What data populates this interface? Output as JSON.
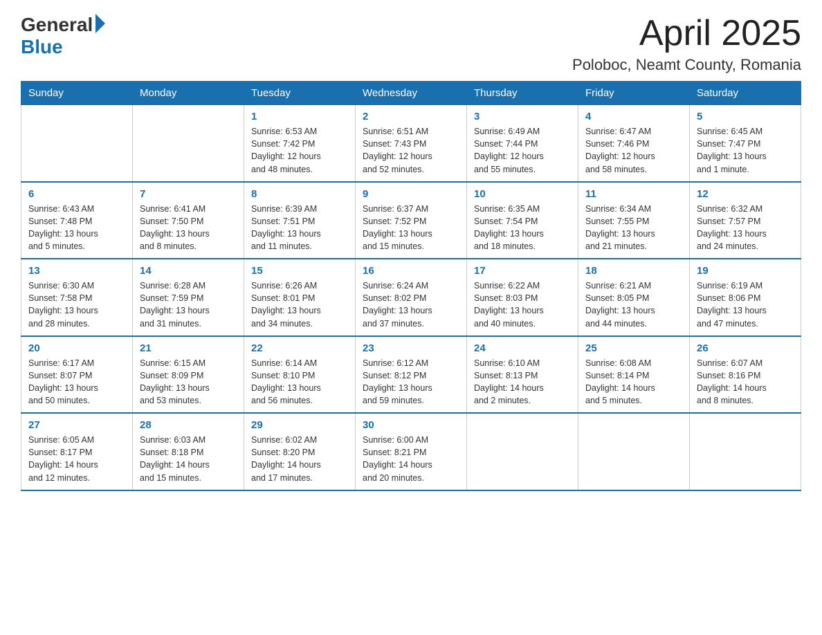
{
  "header": {
    "logo_general": "General",
    "logo_blue": "Blue",
    "month_title": "April 2025",
    "location": "Poloboc, Neamt County, Romania"
  },
  "days_of_week": [
    "Sunday",
    "Monday",
    "Tuesday",
    "Wednesday",
    "Thursday",
    "Friday",
    "Saturday"
  ],
  "weeks": [
    [
      {
        "day": "",
        "info": ""
      },
      {
        "day": "",
        "info": ""
      },
      {
        "day": "1",
        "info": "Sunrise: 6:53 AM\nSunset: 7:42 PM\nDaylight: 12 hours\nand 48 minutes."
      },
      {
        "day": "2",
        "info": "Sunrise: 6:51 AM\nSunset: 7:43 PM\nDaylight: 12 hours\nand 52 minutes."
      },
      {
        "day": "3",
        "info": "Sunrise: 6:49 AM\nSunset: 7:44 PM\nDaylight: 12 hours\nand 55 minutes."
      },
      {
        "day": "4",
        "info": "Sunrise: 6:47 AM\nSunset: 7:46 PM\nDaylight: 12 hours\nand 58 minutes."
      },
      {
        "day": "5",
        "info": "Sunrise: 6:45 AM\nSunset: 7:47 PM\nDaylight: 13 hours\nand 1 minute."
      }
    ],
    [
      {
        "day": "6",
        "info": "Sunrise: 6:43 AM\nSunset: 7:48 PM\nDaylight: 13 hours\nand 5 minutes."
      },
      {
        "day": "7",
        "info": "Sunrise: 6:41 AM\nSunset: 7:50 PM\nDaylight: 13 hours\nand 8 minutes."
      },
      {
        "day": "8",
        "info": "Sunrise: 6:39 AM\nSunset: 7:51 PM\nDaylight: 13 hours\nand 11 minutes."
      },
      {
        "day": "9",
        "info": "Sunrise: 6:37 AM\nSunset: 7:52 PM\nDaylight: 13 hours\nand 15 minutes."
      },
      {
        "day": "10",
        "info": "Sunrise: 6:35 AM\nSunset: 7:54 PM\nDaylight: 13 hours\nand 18 minutes."
      },
      {
        "day": "11",
        "info": "Sunrise: 6:34 AM\nSunset: 7:55 PM\nDaylight: 13 hours\nand 21 minutes."
      },
      {
        "day": "12",
        "info": "Sunrise: 6:32 AM\nSunset: 7:57 PM\nDaylight: 13 hours\nand 24 minutes."
      }
    ],
    [
      {
        "day": "13",
        "info": "Sunrise: 6:30 AM\nSunset: 7:58 PM\nDaylight: 13 hours\nand 28 minutes."
      },
      {
        "day": "14",
        "info": "Sunrise: 6:28 AM\nSunset: 7:59 PM\nDaylight: 13 hours\nand 31 minutes."
      },
      {
        "day": "15",
        "info": "Sunrise: 6:26 AM\nSunset: 8:01 PM\nDaylight: 13 hours\nand 34 minutes."
      },
      {
        "day": "16",
        "info": "Sunrise: 6:24 AM\nSunset: 8:02 PM\nDaylight: 13 hours\nand 37 minutes."
      },
      {
        "day": "17",
        "info": "Sunrise: 6:22 AM\nSunset: 8:03 PM\nDaylight: 13 hours\nand 40 minutes."
      },
      {
        "day": "18",
        "info": "Sunrise: 6:21 AM\nSunset: 8:05 PM\nDaylight: 13 hours\nand 44 minutes."
      },
      {
        "day": "19",
        "info": "Sunrise: 6:19 AM\nSunset: 8:06 PM\nDaylight: 13 hours\nand 47 minutes."
      }
    ],
    [
      {
        "day": "20",
        "info": "Sunrise: 6:17 AM\nSunset: 8:07 PM\nDaylight: 13 hours\nand 50 minutes."
      },
      {
        "day": "21",
        "info": "Sunrise: 6:15 AM\nSunset: 8:09 PM\nDaylight: 13 hours\nand 53 minutes."
      },
      {
        "day": "22",
        "info": "Sunrise: 6:14 AM\nSunset: 8:10 PM\nDaylight: 13 hours\nand 56 minutes."
      },
      {
        "day": "23",
        "info": "Sunrise: 6:12 AM\nSunset: 8:12 PM\nDaylight: 13 hours\nand 59 minutes."
      },
      {
        "day": "24",
        "info": "Sunrise: 6:10 AM\nSunset: 8:13 PM\nDaylight: 14 hours\nand 2 minutes."
      },
      {
        "day": "25",
        "info": "Sunrise: 6:08 AM\nSunset: 8:14 PM\nDaylight: 14 hours\nand 5 minutes."
      },
      {
        "day": "26",
        "info": "Sunrise: 6:07 AM\nSunset: 8:16 PM\nDaylight: 14 hours\nand 8 minutes."
      }
    ],
    [
      {
        "day": "27",
        "info": "Sunrise: 6:05 AM\nSunset: 8:17 PM\nDaylight: 14 hours\nand 12 minutes."
      },
      {
        "day": "28",
        "info": "Sunrise: 6:03 AM\nSunset: 8:18 PM\nDaylight: 14 hours\nand 15 minutes."
      },
      {
        "day": "29",
        "info": "Sunrise: 6:02 AM\nSunset: 8:20 PM\nDaylight: 14 hours\nand 17 minutes."
      },
      {
        "day": "30",
        "info": "Sunrise: 6:00 AM\nSunset: 8:21 PM\nDaylight: 14 hours\nand 20 minutes."
      },
      {
        "day": "",
        "info": ""
      },
      {
        "day": "",
        "info": ""
      },
      {
        "day": "",
        "info": ""
      }
    ]
  ]
}
